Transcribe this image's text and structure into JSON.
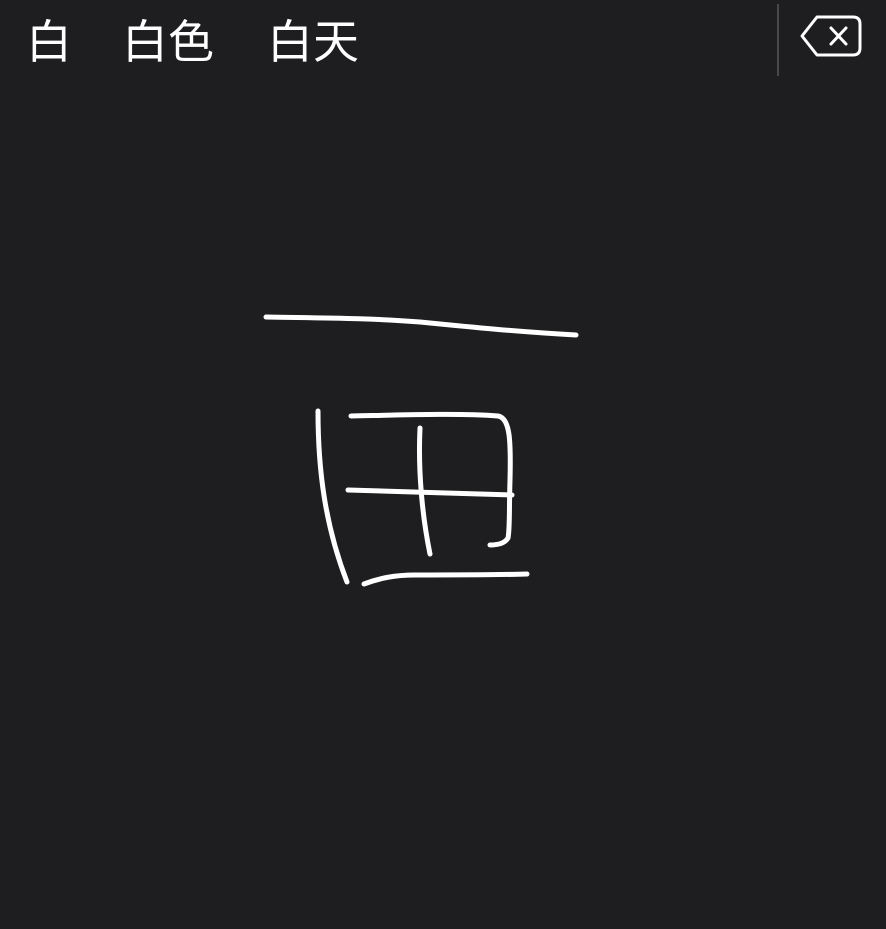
{
  "candidates": [
    "白",
    "白色",
    "白天"
  ],
  "delete_key": {
    "icon": "backspace-icon"
  },
  "handwriting_canvas": {
    "stroke_color": "#ffffff",
    "background_color": "#1e1d20"
  }
}
